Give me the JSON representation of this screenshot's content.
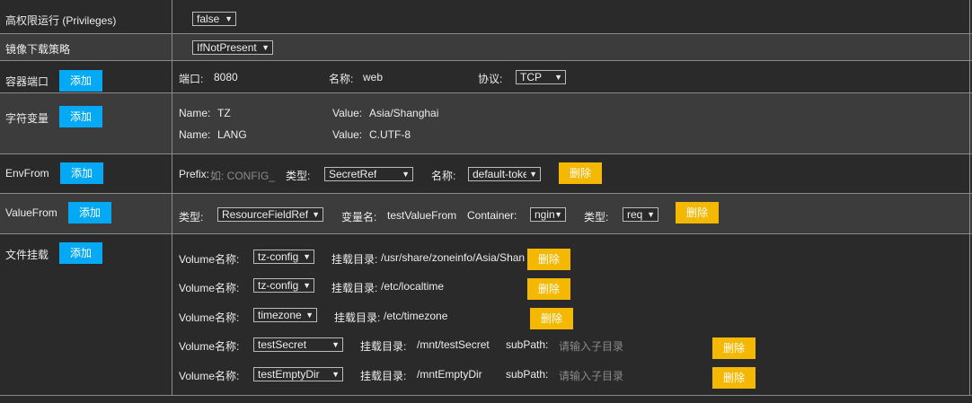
{
  "rows": {
    "privileges": {
      "label": "高权限运行 (Privileges)",
      "value": "false"
    },
    "pull_policy": {
      "label": "镜像下载策略",
      "value": "IfNotPresent"
    },
    "ports": {
      "label": "容器端口",
      "add": "添加",
      "port_label": "端口:",
      "port_value": "8080",
      "name_label": "名称:",
      "name_value": "web",
      "protocol_label": "协议:",
      "protocol_value": "TCP"
    },
    "env": {
      "label": "字符变量",
      "add": "添加",
      "items": [
        {
          "name_label": "Name:",
          "name": "TZ",
          "value_label": "Value:",
          "value": "Asia/Shanghai"
        },
        {
          "name_label": "Name:",
          "name": "LANG",
          "value_label": "Value:",
          "value": "C.UTF-8"
        }
      ]
    },
    "envfrom": {
      "label": "EnvFrom",
      "add": "添加",
      "prefix_label": "Prefix:",
      "prefix_placeholder": "如: CONFIG_",
      "type_label": "类型:",
      "type_value": "SecretRef",
      "name_label": "名称:",
      "name_value": "default-toke",
      "delete": "删除"
    },
    "valuefrom": {
      "label": "ValueFrom",
      "add": "添加",
      "type_label": "类型:",
      "type_value": "ResourceFieldRef",
      "var_label": "变量名:",
      "var_value": "testValueFrom",
      "container_label": "Container:",
      "container_value": "ngin",
      "type2_label": "类型:",
      "type2_value": "req",
      "delete": "删除"
    },
    "volumes": {
      "label": "文件挂载",
      "add": "添加",
      "items": [
        {
          "vol_label": "Volume名称:",
          "vol": "tz-config",
          "mount_label": "挂载目录:",
          "mount": "/usr/share/zoneinfo/Asia/Shan",
          "delete": "删除"
        },
        {
          "vol_label": "Volume名称:",
          "vol": "tz-config",
          "mount_label": "挂载目录:",
          "mount": "/etc/localtime",
          "delete": "删除"
        },
        {
          "vol_label": "Volume名称:",
          "vol": "timezone",
          "mount_label": "挂载目录:",
          "mount": "/etc/timezone",
          "delete": "删除"
        },
        {
          "vol_label": "Volume名称:",
          "vol": "testSecret",
          "mount_label": "挂载目录:",
          "mount": "/mnt/testSecret",
          "subpath_label": "subPath:",
          "subpath_placeholder": "请输入子目录",
          "delete": "删除"
        },
        {
          "vol_label": "Volume名称:",
          "vol": "testEmptyDir",
          "mount_label": "挂载目录:",
          "mount": "/mntEmptyDir",
          "subpath_label": "subPath:",
          "subpath_placeholder": "请输入子目录",
          "delete": "删除"
        }
      ]
    }
  },
  "colors": {
    "add_button": "#03a9f4",
    "delete_button": "#f5b800",
    "background": "#2a2a2a",
    "alt_row": "#3c3c3c",
    "border": "#8a8a8a"
  },
  "icons": {
    "select_arrow": "chevron-down-icon"
  }
}
